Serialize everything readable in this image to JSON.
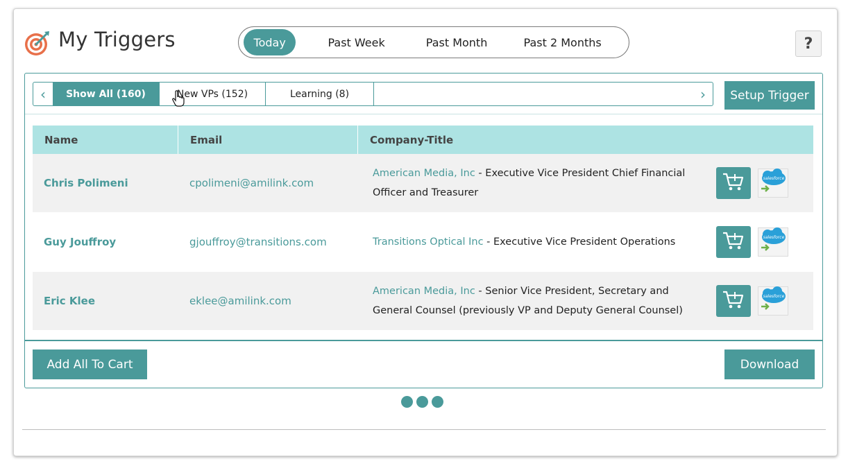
{
  "header": {
    "title": "My Triggers",
    "logo_icon": "target-icon",
    "help_label": "?"
  },
  "periods": [
    {
      "label": "Today",
      "active": true
    },
    {
      "label": "Past Week",
      "active": false
    },
    {
      "label": "Past Month",
      "active": false
    },
    {
      "label": "Past 2 Months",
      "active": false
    }
  ],
  "filters": {
    "prev_label": "‹",
    "next_label": "›",
    "tabs": [
      {
        "label": "Show All (160)",
        "active": true
      },
      {
        "label": "New VPs (152)",
        "active": false
      },
      {
        "label": "Learning (8)",
        "active": false
      }
    ]
  },
  "setup_trigger_label": "Setup Trigger",
  "table": {
    "columns": [
      "Name",
      "Email",
      "Company-Title"
    ],
    "rows": [
      {
        "name": "Chris Polimeni",
        "email": "cpolimeni@amilink.com",
        "company": "American Media, Inc",
        "title": " - Executive Vice President Chief Financial Officer and Treasurer"
      },
      {
        "name": "Guy Jouffroy",
        "email": "gjouffroy@transitions.com",
        "company": "Transitions Optical Inc",
        "title": " - Executive Vice President Operations"
      },
      {
        "name": "Eric Klee",
        "email": "eklee@amilink.com",
        "company": "American Media, Inc",
        "title": " - Senior Vice President, Secretary and General Counsel (previously VP and Deputy General Counsel)"
      }
    ],
    "row_actions": {
      "cart_icon": "add-to-cart-icon",
      "crm_icon": "salesforce-icon",
      "crm_label": "salesforce"
    }
  },
  "footer": {
    "add_all_label": "Add All To Cart",
    "download_label": "Download"
  },
  "colors": {
    "accent": "#4a9a9a",
    "header_row": "#ade3e3",
    "row_alt": "#f1f1f1",
    "salesforce": "#2aa0d8"
  }
}
